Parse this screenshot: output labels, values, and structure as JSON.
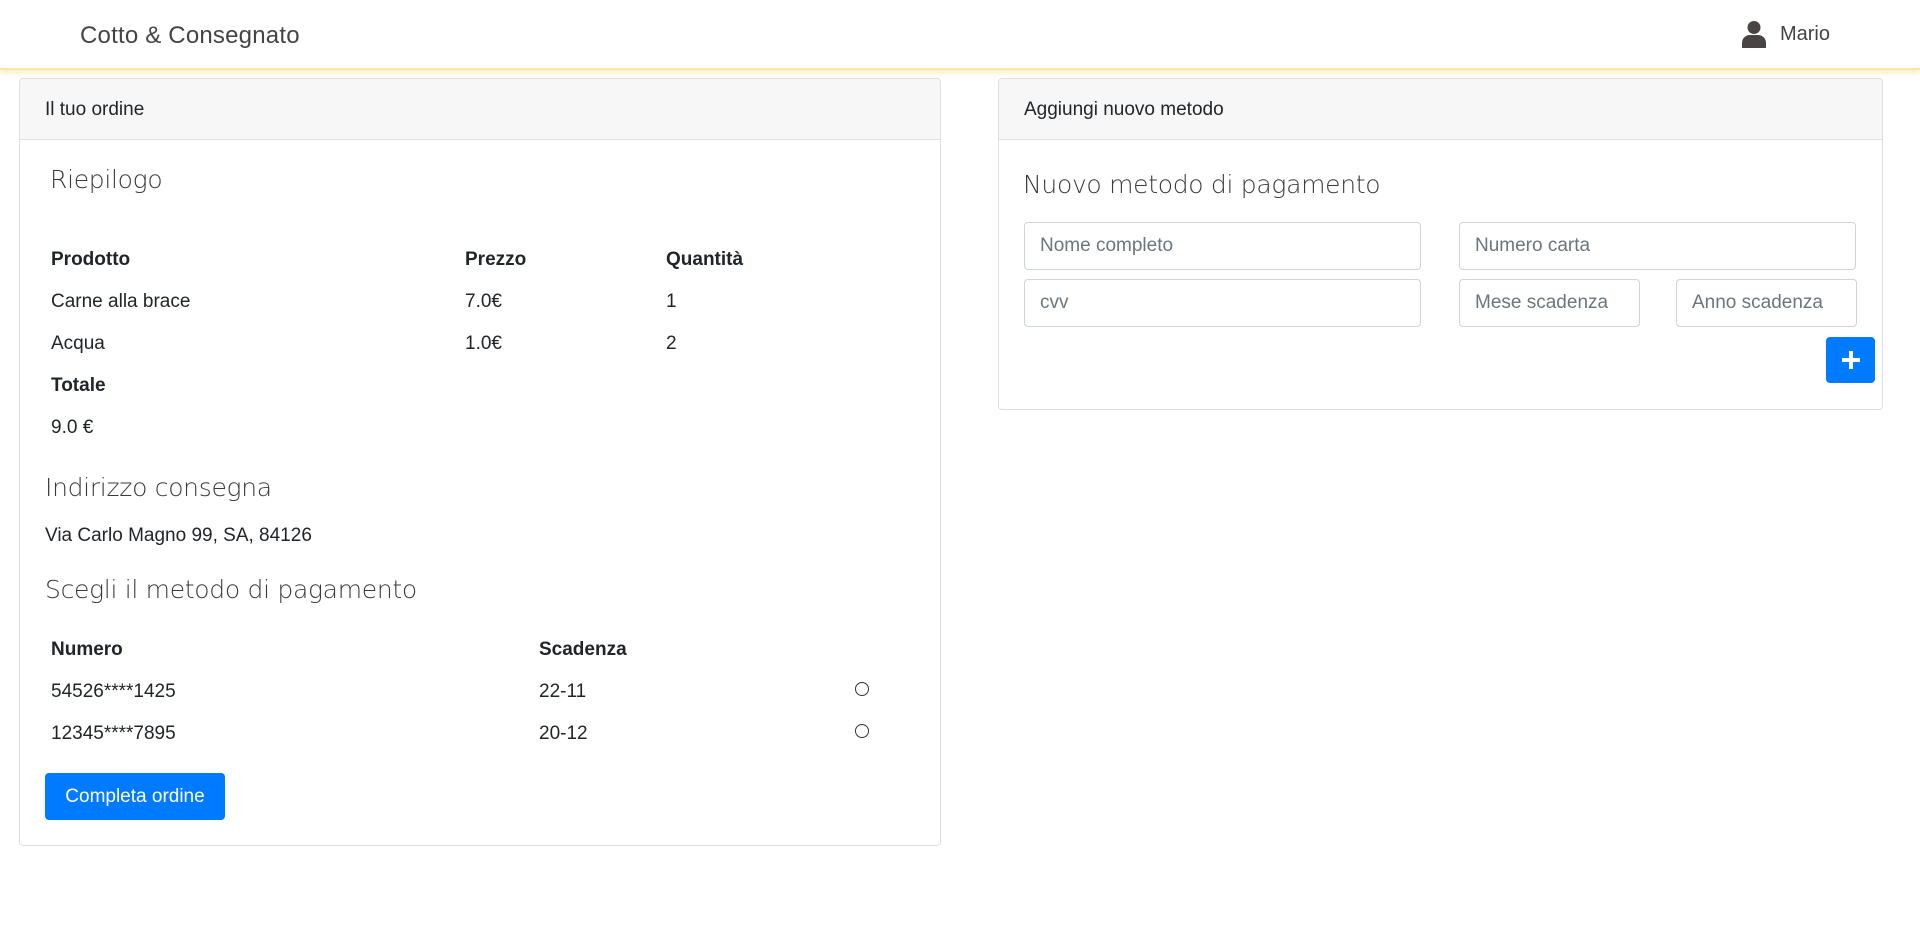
{
  "navbar": {
    "brand": "Cotto & Consegnato",
    "user_name": "Mario",
    "user_icon": "user-icon"
  },
  "order": {
    "header": "Il tuo ordine",
    "summary_title": "Riepilogo",
    "columns": [
      "Prodotto",
      "Prezzo",
      "Quantità"
    ],
    "items": [
      {
        "product": "Carne alla brace",
        "price": "7.0€",
        "qty": "1"
      },
      {
        "product": "Acqua",
        "price": "1.0€",
        "qty": "2"
      }
    ],
    "total_label": "Totale",
    "total_value": "9.0 €",
    "address_title": "Indirizzo consegna",
    "address": "Via Carlo Magno 99, SA, 84126",
    "payment_title": "Scegli il metodo di pagamento",
    "payment_columns": [
      "Numero",
      "Scadenza"
    ],
    "payment_methods": [
      {
        "number": "54526****1425",
        "expiry": "22-11"
      },
      {
        "number": "12345****7895",
        "expiry": "20-12"
      }
    ],
    "submit_label": "Completa ordine"
  },
  "new_method": {
    "header": "Aggiungi nuovo metodo",
    "title": "Nuovo metodo di pagamento",
    "placeholders": {
      "full_name": "Nome completo",
      "card_number": "Numero carta",
      "cvv": "cvv",
      "exp_month": "Mese scadenza",
      "exp_year": "Anno scadenza"
    },
    "add_icon": "plus-icon"
  },
  "colors": {
    "primary": "#007bff",
    "navbar_shadow": "#f6e7a6"
  }
}
